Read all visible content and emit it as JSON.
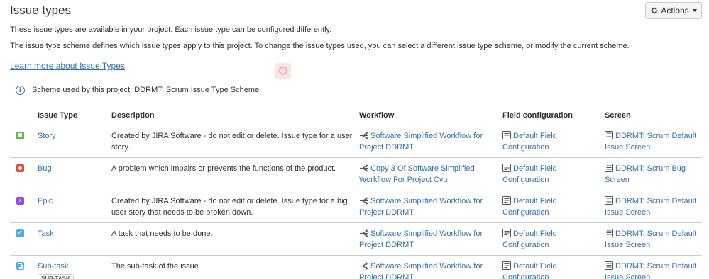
{
  "page": {
    "title": "Issue types",
    "actions_label": "Actions",
    "intro": "These issue types are available in your project. Each issue type can be configured differently.",
    "scheme_help": "The issue type scheme defines which issue types apply to this project. To change the issue types used, you can select a different issue type scheme, or modify the current scheme.",
    "learn_more": "Learn more about Issue Types",
    "scheme_text": "Scheme used by this project:  DDRMT: Scrum Issue Type Scheme"
  },
  "table": {
    "headers": {
      "issue_type": "Issue Type",
      "description": "Description",
      "workflow": "Workflow",
      "field_configuration": "Field configuration",
      "screen": "Screen"
    },
    "rows": [
      {
        "icon": "story-icon",
        "name": "Story",
        "description": "Created by JIRA Software - do not edit or delete. Issue type for a user story.",
        "workflow": "Software Simplified Workflow for Project DDRMT",
        "field_config": "Default Field Configuration",
        "screen": "DDRMT: Scrum Default Issue Screen"
      },
      {
        "icon": "bug-icon",
        "name": "Bug",
        "description": "A problem which impairs or prevents the functions of the product.",
        "workflow": "Copy 3 Of Software Simplified Workflow For Project Cvu",
        "field_config": "Default Field Configuration",
        "screen": "DDRMT: Scrum Bug Screen"
      },
      {
        "icon": "epic-icon",
        "name": "Epic",
        "description": "Created by JIRA Software - do not edit or delete. Issue type for a big user story that needs to be broken down.",
        "workflow": "Software Simplified Workflow for Project DDRMT",
        "field_config": "Default Field Configuration",
        "screen": "DDRMT: Scrum Default Issue Screen"
      },
      {
        "icon": "task-icon",
        "name": "Task",
        "description": "A task that needs to be done.",
        "workflow": "Software Simplified Workflow for Project DDRMT",
        "field_config": "Default Field Configuration",
        "screen": "DDRMT: Scrum Default Issue Screen"
      },
      {
        "icon": "subtask-icon",
        "name": "Sub-task",
        "lozenge": "SUB-TASK",
        "description": "The sub-task of the issue",
        "workflow": "Software Simplified Workflow for Project DDRMT",
        "field_config": "Default Field Configuration",
        "screen": "DDRMT: Scrum Default Issue Screen"
      }
    ]
  },
  "colors": {
    "link": "#3572b0",
    "story": "#63ba3c",
    "bug": "#e5493a",
    "epic": "#904ee2",
    "task": "#4bade8"
  }
}
